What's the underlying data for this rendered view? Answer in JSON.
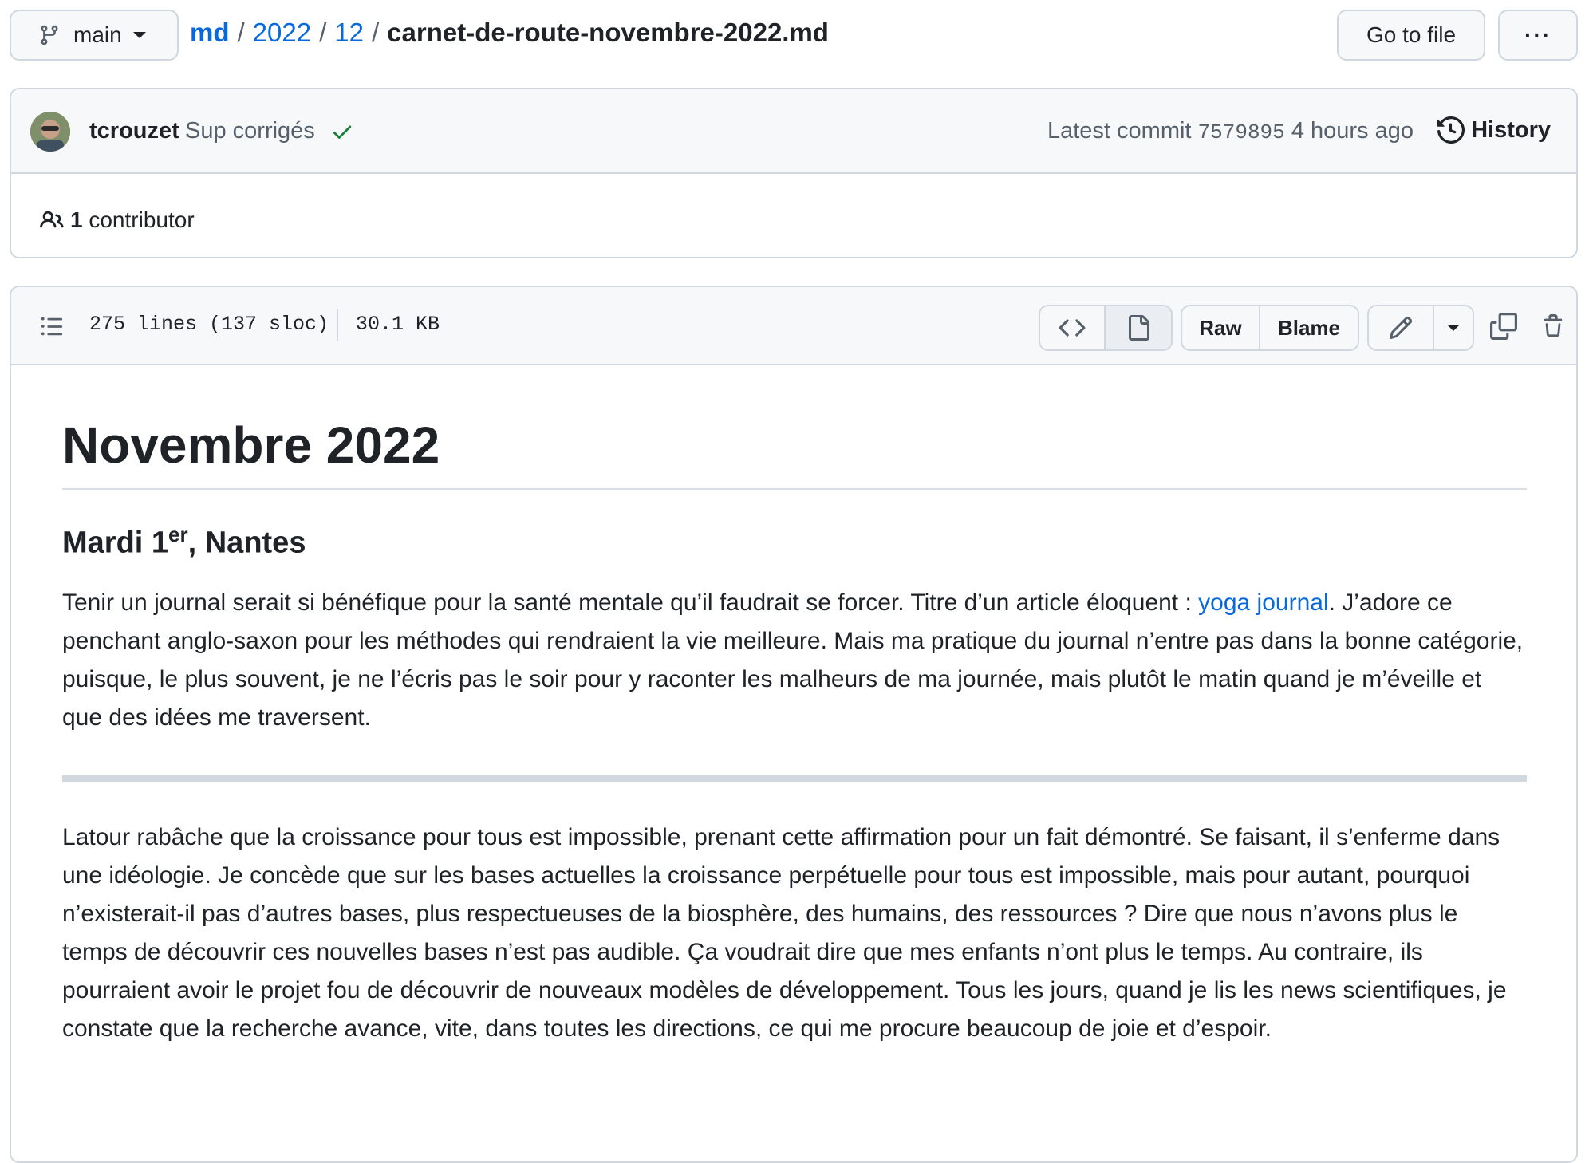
{
  "topbar": {
    "branch": "main",
    "breadcrumb": [
      "md",
      "2022",
      "12"
    ],
    "filename": "carnet-de-route-novembre-2022.md",
    "separator": "/",
    "goto_file": "Go to file",
    "more": "···"
  },
  "commit": {
    "author": "tcrouzet",
    "message": "Sup corrigés",
    "latest_label": "Latest commit",
    "sha": "7579895",
    "time": "4 hours ago",
    "history": "History",
    "contributors_count": "1",
    "contributors_label": "contributor"
  },
  "file": {
    "lines": "275 lines (137 sloc)",
    "size": "30.1 KB",
    "raw": "Raw",
    "blame": "Blame"
  },
  "content": {
    "h1": "Novembre 2022",
    "h2_pre": "Mardi 1",
    "h2_sup": "er",
    "h2_post": ", Nantes",
    "p1_before": "Tenir un journal serait si bénéfique pour la santé mentale qu’il faudrait se forcer. Titre d’un article éloquent : ",
    "p1_link": "yoga journal",
    "p1_after": ". J’adore ce penchant anglo-saxon pour les méthodes qui rendraient la vie meilleure. Mais ma pratique du journal n’entre pas dans la bonne catégorie, puisque, le plus souvent, je ne l’écris pas le soir pour y raconter les malheurs de ma journée, mais plutôt le matin quand je m’éveille et que des idées me traversent.",
    "p2": "Latour rabâche que la croissance pour tous est impossible, prenant cette affirmation pour un fait démontré. Se faisant, il s’enferme dans une idéologie. Je concède que sur les bases actuelles la croissance perpétuelle pour tous est impossible, mais pour autant, pourquoi n’existerait-il pas d’autres bases, plus respectueuses de la biosphère, des humains, des ressources ? Dire que nous n’avons plus le temps de découvrir ces nouvelles bases n’est pas audible. Ça voudrait dire que mes enfants n’ont plus le temps. Au contraire, ils pourraient avoir le projet fou de découvrir de nouveaux modèles de développement. Tous les jours, quand je lis les news scientifiques, je constate que la recherche avance, vite, dans toutes les directions, ce qui me procure beaucoup de joie et d’espoir."
  },
  "colors": {
    "link": "#0969da",
    "border": "#d0d7de",
    "bar_bg": "#f6f8fa",
    "success": "#1a7f37"
  },
  "icons": [
    "git-branch-icon",
    "chevron-down-icon",
    "kebab-horizontal-icon",
    "avatar",
    "check-icon",
    "history-icon",
    "people-icon",
    "list-outline-icon",
    "code-icon",
    "file-icon",
    "pencil-icon",
    "triangle-down-icon",
    "copy-icon",
    "trash-icon"
  ]
}
